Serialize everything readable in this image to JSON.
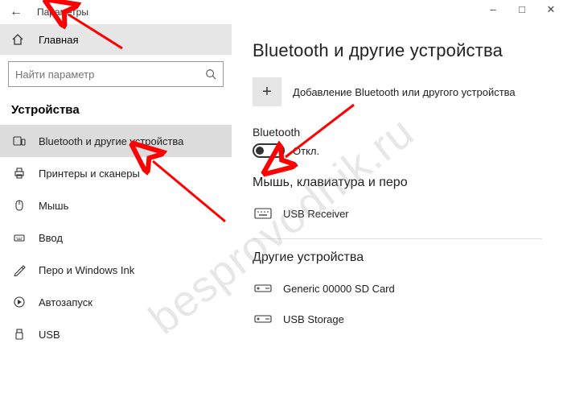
{
  "window": {
    "title": "Параметры"
  },
  "sidebar": {
    "home": "Главная",
    "search_placeholder": "Найти параметр",
    "section": "Устройства",
    "items": [
      {
        "label": "Bluetooth и другие устройства"
      },
      {
        "label": "Принтеры и сканеры"
      },
      {
        "label": "Мышь"
      },
      {
        "label": "Ввод"
      },
      {
        "label": "Перо и Windows Ink"
      },
      {
        "label": "Автозапуск"
      },
      {
        "label": "USB"
      }
    ]
  },
  "main": {
    "title": "Bluetooth и другие устройства",
    "add_label": "Добавление Bluetooth или другого устройства",
    "bt_label": "Bluetooth",
    "bt_state": "Откл.",
    "group1_title": "Мышь, клавиатура и перо",
    "group1_items": [
      {
        "label": "USB Receiver"
      }
    ],
    "group2_title": "Другие устройства",
    "group2_items": [
      {
        "label": "Generic 00000 SD Card"
      },
      {
        "label": "USB Storage"
      }
    ]
  },
  "watermark": "besprovodnik.ru"
}
